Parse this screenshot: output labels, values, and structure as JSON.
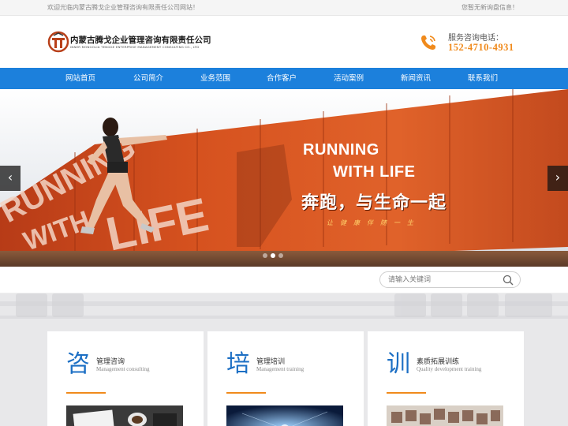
{
  "topbar": {
    "welcome": "欢迎光临内蒙古腾戈企业管理咨询有限责任公司网站！",
    "notice": "您暂无新询盘信息！"
  },
  "header": {
    "logo_cn": "内蒙古腾戈企业管理咨询有限责任公司",
    "logo_en": "INNER MONGOLIA TENGGE ENTERPRISE MANAGEMENT CONSULTING CO., LTD",
    "hotline_label": "服务咨询电话：",
    "hotline_number": "152-4710-4931"
  },
  "nav": {
    "items": [
      {
        "label": "网站首页"
      },
      {
        "label": "公司简介"
      },
      {
        "label": "业务范围"
      },
      {
        "label": "合作客户"
      },
      {
        "label": "活动案例"
      },
      {
        "label": "新闻资讯"
      },
      {
        "label": "联系我们"
      }
    ]
  },
  "banner": {
    "line1": "RUNNING",
    "line2": "WITH LIFE",
    "cn_title": "奔跑，与生命一起",
    "cn_sub": "让健康伴随一生",
    "wall_text_1": "RUNNING",
    "wall_text_2": "WITH",
    "wall_text_3": "LIFE",
    "prev": "‹",
    "next": "›",
    "slide_count": 3,
    "active_slide": 2
  },
  "search": {
    "placeholder": "请输入关键词"
  },
  "services": {
    "cards": [
      {
        "char": "咨",
        "title": "管理咨询",
        "subtitle": "Management consulting"
      },
      {
        "char": "培",
        "title": "管理培训",
        "subtitle": "Management training"
      },
      {
        "char": "训",
        "title": "素质拓展训练",
        "subtitle": "Quality development training"
      }
    ]
  },
  "colors": {
    "nav_blue": "#1c80dc",
    "accent_orange": "#f08a1c",
    "banner_red": "#c9471c"
  },
  "icons": {
    "phone": "phone-icon",
    "search": "search-icon",
    "logo": "logo-mark-icon"
  }
}
